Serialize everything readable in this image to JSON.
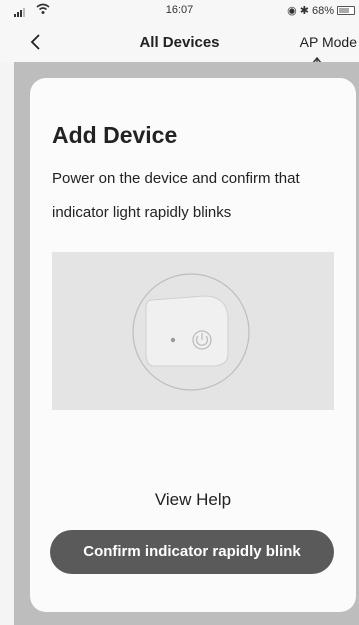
{
  "status_bar": {
    "time": "16:07",
    "battery_text": "68%",
    "battery_level": 0.68,
    "icons": [
      "signal-icon",
      "wifi-icon",
      "alarm-icon",
      "bluetooth-icon",
      "battery-icon"
    ]
  },
  "nav": {
    "title": "All Devices",
    "right_action": "AP Mode",
    "back_icon": "chevron-left-icon"
  },
  "card": {
    "heading": "Add Device",
    "description": "Power on the device and confirm that indicator light rapidly blinks",
    "illustration_icon": "power-icon",
    "view_help": "View Help",
    "confirm_button": "Confirm indicator rapidly blink"
  }
}
